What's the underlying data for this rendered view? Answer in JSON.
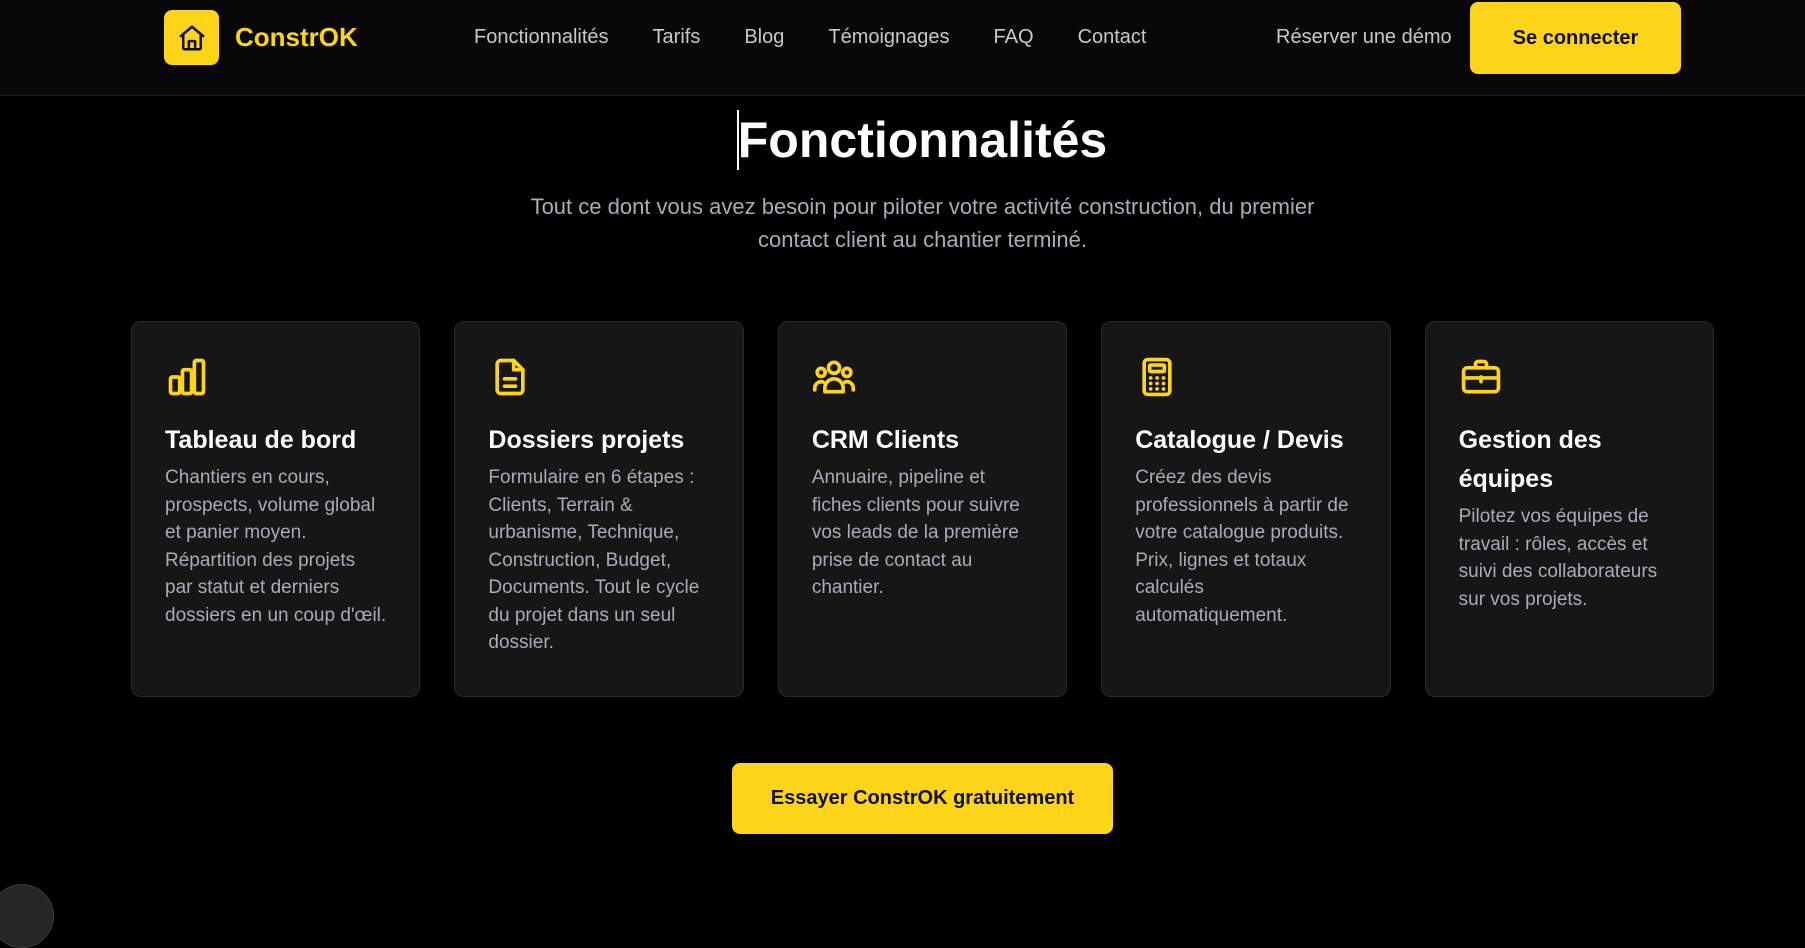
{
  "brand": {
    "name": "ConstrOK",
    "accent_color": "#fed418",
    "logo_icon": "home-icon"
  },
  "nav": {
    "links": [
      "Fonctionnalités",
      "Tarifs",
      "Blog",
      "Témoignages",
      "FAQ",
      "Contact"
    ],
    "demo_label": "Réserver une démo",
    "login_label": "Se connecter"
  },
  "hero": {
    "title": "Fonctionnalités",
    "subtitle_line1": "Tout ce dont vous avez besoin pour piloter votre activité construction, du premier",
    "subtitle_line2": "contact client au chantier terminé."
  },
  "features": [
    {
      "icon": "bar-chart-icon",
      "title": "Tableau de bord",
      "text": "Chantiers en cours, prospects, volume global et panier moyen. Répartition des projets par statut et derniers dossiers en un coup d'œil."
    },
    {
      "icon": "file-icon",
      "title": "Dossiers projets",
      "text": "Formulaire en 6 étapes : Clients, Terrain & urbanisme, Technique, Construction, Budget, Documents. Tout le cycle du projet dans un seul dossier."
    },
    {
      "icon": "users-icon",
      "title": "CRM Clients",
      "text": "Annuaire, pipeline et fiches clients pour suivre vos leads de la première prise de contact au chantier."
    },
    {
      "icon": "calculator-icon",
      "title": "Catalogue / Devis",
      "text": "Créez des devis professionnels à partir de votre catalogue produits. Prix, lignes et totaux calculés automatiquement."
    },
    {
      "icon": "briefcase-icon",
      "title": "Gestion des équipes",
      "text": "Pilotez vos équipes de travail : rôles, accès et suivi des collaborateurs sur vos projets."
    }
  ],
  "cta": {
    "label": "Essayer ConstrOK gratuitement"
  }
}
